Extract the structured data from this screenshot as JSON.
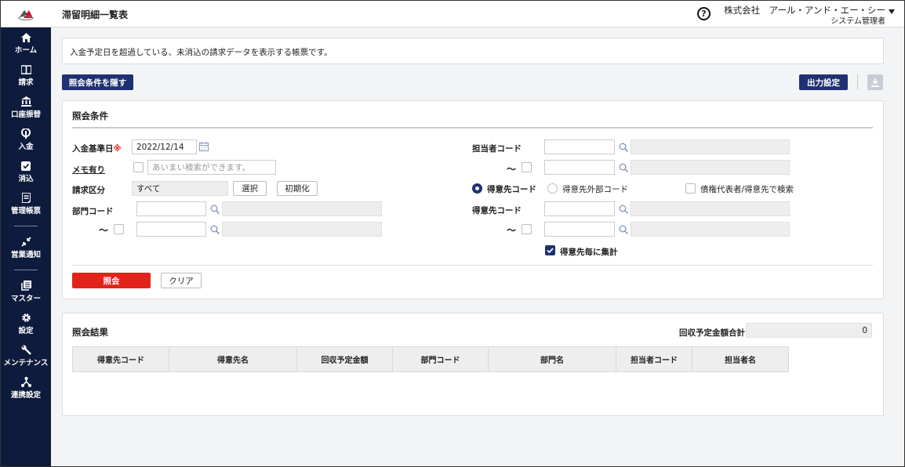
{
  "header": {
    "title": "滞留明細一覧表",
    "company": "株式会社　アール・アンド・エー・シー",
    "user_role": "システム管理者",
    "help_glyph": "?"
  },
  "sidebar": {
    "items": [
      {
        "label": "ホーム",
        "icon": "home-icon"
      },
      {
        "label": "請求",
        "icon": "book-icon"
      },
      {
        "label": "口座振替",
        "icon": "bank-icon"
      },
      {
        "label": "入金",
        "icon": "deposit-icon"
      },
      {
        "label": "消込",
        "icon": "check-icon"
      },
      {
        "label": "管理帳票",
        "icon": "report-icon"
      },
      {
        "label": "営業通知",
        "icon": "notify-icon"
      },
      {
        "label": "マスター",
        "icon": "master-icon"
      },
      {
        "label": "設定",
        "icon": "gear-icon"
      },
      {
        "label": "メンテナンス",
        "icon": "wrench-icon"
      },
      {
        "label": "連携設定",
        "icon": "network-icon"
      }
    ]
  },
  "description": "入金予定日を超過している、未消込の請求データを表示する帳票です。",
  "toolbar": {
    "toggle_conditions_label": "照会条件を隠す",
    "output_settings_label": "出力設定"
  },
  "conditions": {
    "title": "照会条件",
    "base_date_label": "入金基準日",
    "required_mark": "※",
    "base_date_value": "2022/12/14",
    "memo_label": "メモ有り",
    "memo_placeholder": "あいまい検索ができます。",
    "billing_type_label": "請求区分",
    "billing_type_value": "すべて",
    "select_label": "選択",
    "reset_label": "初期化",
    "dept_code_label": "部門コード",
    "tilde": "～",
    "staff_code_label": "担当者コード",
    "radio_customer_code": "得意先コード",
    "radio_customer_ext_code": "得意先外部コード",
    "creditor_search_label": "債権代表者/得意先で検索",
    "customer_code_label": "得意先コード",
    "aggregate_label": "得意先毎に集計",
    "search_label": "照会",
    "clear_label": "クリア"
  },
  "results": {
    "title": "照会結果",
    "total_label": "回収予定金額合計",
    "total_value": "0",
    "columns": [
      "得意先コード",
      "得意先名",
      "回収予定金額",
      "部門コード",
      "部門名",
      "担当者コード",
      "担当者名"
    ]
  },
  "colors": {
    "navy": "#1f3170",
    "sidebar": "#0d1b3d",
    "danger": "#e2231a"
  }
}
